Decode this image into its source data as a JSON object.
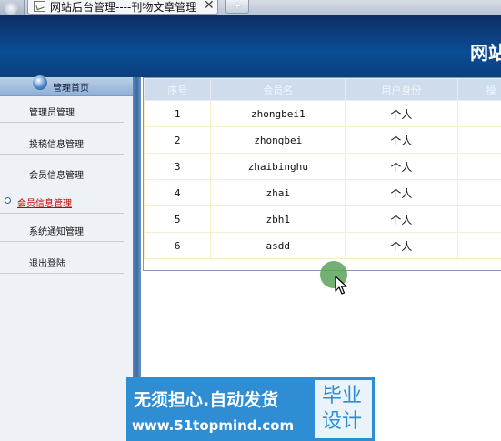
{
  "browser": {
    "tab_title": "网站后台管理----刊物文章管理",
    "close_glyph": "✕",
    "new_tab_glyph": "+"
  },
  "header": {
    "title": "网站"
  },
  "sidebar": {
    "heading": "管理首页",
    "items": [
      {
        "label": "管理员管理",
        "active": false
      },
      {
        "label": "投稿信息管理",
        "active": false
      },
      {
        "label": "会员信息管理",
        "active": false
      },
      {
        "label": "会员信息管理",
        "active": true
      },
      {
        "label": "系统通知管理",
        "active": false
      },
      {
        "label": "退出登陆",
        "active": false
      }
    ]
  },
  "table": {
    "columns": [
      "序号",
      "会员名",
      "用户身份",
      "操"
    ],
    "rows": [
      {
        "no": "1",
        "name": "zhongbei1",
        "role": "个人"
      },
      {
        "no": "2",
        "name": "zhongbei",
        "role": "个人"
      },
      {
        "no": "3",
        "name": "zhaibinghu",
        "role": "个人"
      },
      {
        "no": "4",
        "name": "zhai",
        "role": "个人"
      },
      {
        "no": "5",
        "name": "zbh1",
        "role": "个人"
      },
      {
        "no": "6",
        "name": "asdd",
        "role": "个人"
      }
    ]
  },
  "banner": {
    "slogan": "无须担心.自动发货",
    "url": "www.51topmind.com",
    "line1": "毕业",
    "line2": "设计"
  },
  "colors": {
    "header_bg": "#0a4d94",
    "sidebar_bg": "#eef2f7",
    "table_header_bg": "#cfdcec",
    "active_link": "#c00000",
    "banner_bg": "#2f8ed3",
    "cursor_highlight": "#5aa35a"
  }
}
